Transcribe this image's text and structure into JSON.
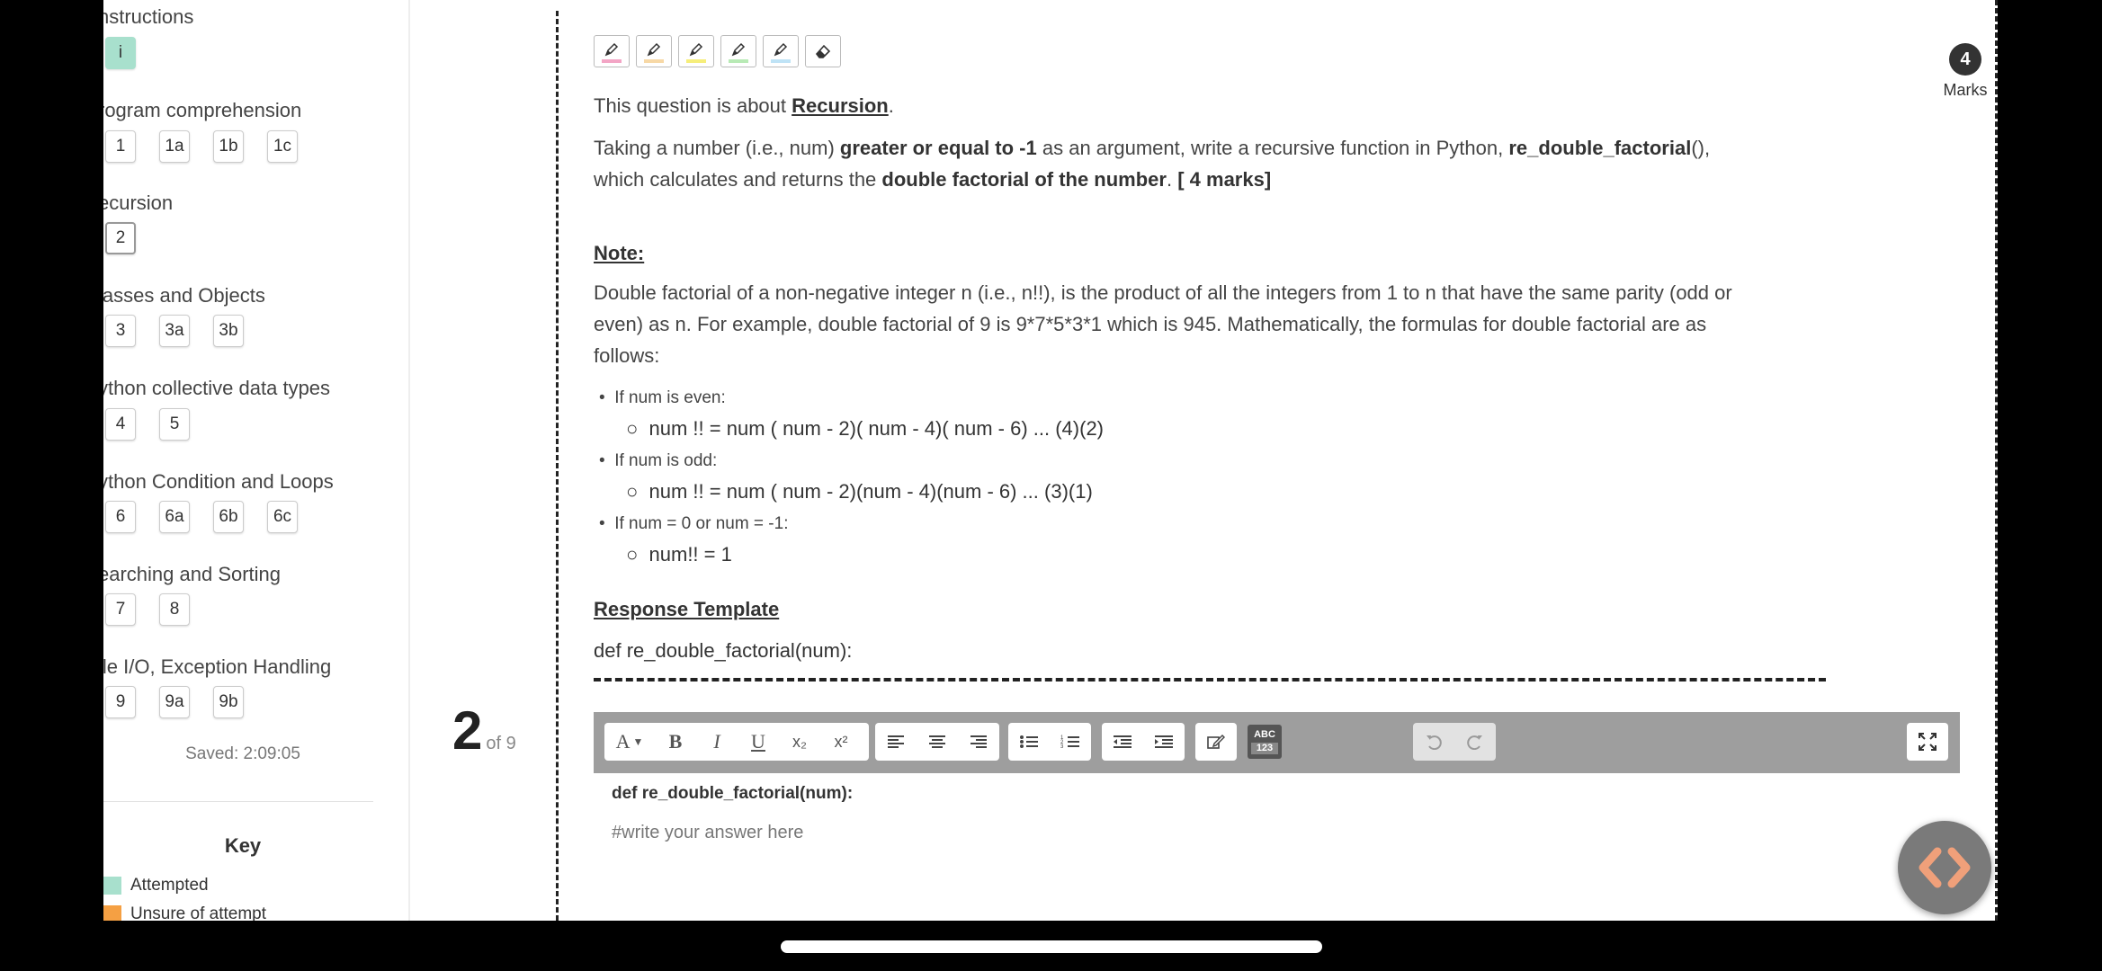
{
  "sidebar": {
    "sections": [
      {
        "title": "nstructions",
        "items": [
          "i"
        ]
      },
      {
        "title": "rogram comprehension",
        "items": [
          "1",
          "1a",
          "1b",
          "1c"
        ]
      },
      {
        "title": "ecursion",
        "items": [
          "2"
        ]
      },
      {
        "title": "lasses and Objects",
        "items": [
          "3",
          "3a",
          "3b"
        ]
      },
      {
        "title": "ython collective data types",
        "items": [
          "4",
          "5"
        ]
      },
      {
        "title": "ython Condition and Loops",
        "items": [
          "6",
          "6a",
          "6b",
          "6c"
        ]
      },
      {
        "title": "earching and Sorting",
        "items": [
          "7",
          "8"
        ]
      },
      {
        "title": "ile I/O, Exception Handling",
        "items": [
          "9",
          "9a",
          "9b"
        ]
      }
    ],
    "current_item": "2",
    "saved": "Saved: 2:09:05",
    "key": {
      "title": "Key",
      "items": [
        {
          "label": "Attempted",
          "color": "#a8e0cd"
        },
        {
          "label": "Unsure of attempt",
          "color": "#f5a043"
        }
      ]
    }
  },
  "question_counter": {
    "number": "2",
    "of": "of 9"
  },
  "highlighters": [
    {
      "name": "highlighter-pink-icon",
      "color": "#f3a5c5"
    },
    {
      "name": "highlighter-orange-icon",
      "color": "#f7d8a6"
    },
    {
      "name": "highlighter-yellow-icon",
      "color": "#f6ee7a"
    },
    {
      "name": "highlighter-green-icon",
      "color": "#b8eab5"
    },
    {
      "name": "highlighter-blue-icon",
      "color": "#bfe3f6"
    },
    {
      "name": "eraser-icon",
      "color": ""
    }
  ],
  "marks": {
    "value": "4",
    "label": "Marks"
  },
  "question": {
    "intro_prefix": "This question is about ",
    "intro_topic": "Recursion",
    "intro_suffix": ".",
    "task": {
      "p1": "Taking a number (i.e.,  num) ",
      "b1": "greater or equal to -1",
      "p2": " as an argument, write a recursive function in Python, ",
      "b2": "re_double_factorial",
      "p3": "(),",
      "p4": "which calculates and returns the ",
      "b3": "double factorial of the number",
      "p5": ". ",
      "b4": "[ 4 marks]"
    },
    "note_heading": "Note:",
    "note_line1": "Double factorial of a non-negative integer n (i.e., n!!), is the product of all the integers from 1 to n that have the same parity (odd or",
    "note_line2": "even) as n. For example, double factorial of 9 is 9*7*5*3*1 which is 945. Mathematically, the formulas for double factorial are as",
    "note_line3": "follows:",
    "cases": [
      {
        "condition": "If num is even:",
        "formula": "num !! = num ( num - 2)( num - 4)( num - 6) ... (4)(2)"
      },
      {
        "condition": "If num is odd:",
        "formula": "num !! = num ( num - 2)(num - 4)(num - 6) ... (3)(1)"
      },
      {
        "condition": "If num = 0 or num = -1:",
        "formula": "num!! = 1"
      }
    ],
    "template_heading": "Response Template",
    "template_code": "def re_double_factorial(num):"
  },
  "editor": {
    "toolbar": {
      "font": "A",
      "bold": "B",
      "italic": "I",
      "underline": "U",
      "subscript": "x₂",
      "superscript": "x²",
      "spellcheck_top": "ABC",
      "spellcheck_bottom": "123"
    },
    "content_code": "def re_double_factorial(num):",
    "placeholder": "#write your answer here"
  }
}
